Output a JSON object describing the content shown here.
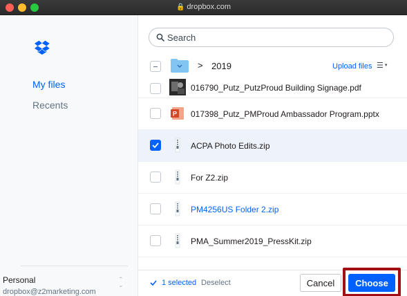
{
  "window": {
    "url": "dropbox.com"
  },
  "sidebar": {
    "items": [
      {
        "label": "My files",
        "active": true
      },
      {
        "label": "Recents",
        "active": false
      }
    ],
    "account": {
      "name": "Personal",
      "email": "dropbox@z2marketing.com"
    }
  },
  "search": {
    "placeholder": "Search"
  },
  "breadcrumb": {
    "separator": ">",
    "folder": "2019"
  },
  "toolbar": {
    "upload_label": "Upload files",
    "view_icon": "list-view-icon",
    "caret": "▾"
  },
  "files": [
    {
      "name": "016790_Putz_PutzProud Building Signage.pdf",
      "icon": "image-thumbnail",
      "checked": false,
      "link": false
    },
    {
      "name": "017398_Putz_PMProud Ambassador Program.pptx",
      "icon": "powerpoint-icon",
      "checked": false,
      "link": false
    },
    {
      "name": "ACPA Photo Edits.zip",
      "icon": "zip-icon",
      "checked": true,
      "link": false
    },
    {
      "name": "For Z2.zip",
      "icon": "zip-icon",
      "checked": false,
      "link": false
    },
    {
      "name": "PM4256US Folder 2.zip",
      "icon": "zip-icon",
      "checked": false,
      "link": true
    },
    {
      "name": "PMA_Summer2019_PressKit.zip",
      "icon": "zip-icon",
      "checked": false,
      "link": false
    }
  ],
  "footer": {
    "selected_label": "1 selected",
    "deselect_label": "Deselect",
    "cancel_label": "Cancel",
    "choose_label": "Choose"
  },
  "colors": {
    "accent": "#0061fe",
    "highlight": "#a10f14",
    "selected_row": "#eef3fb"
  }
}
